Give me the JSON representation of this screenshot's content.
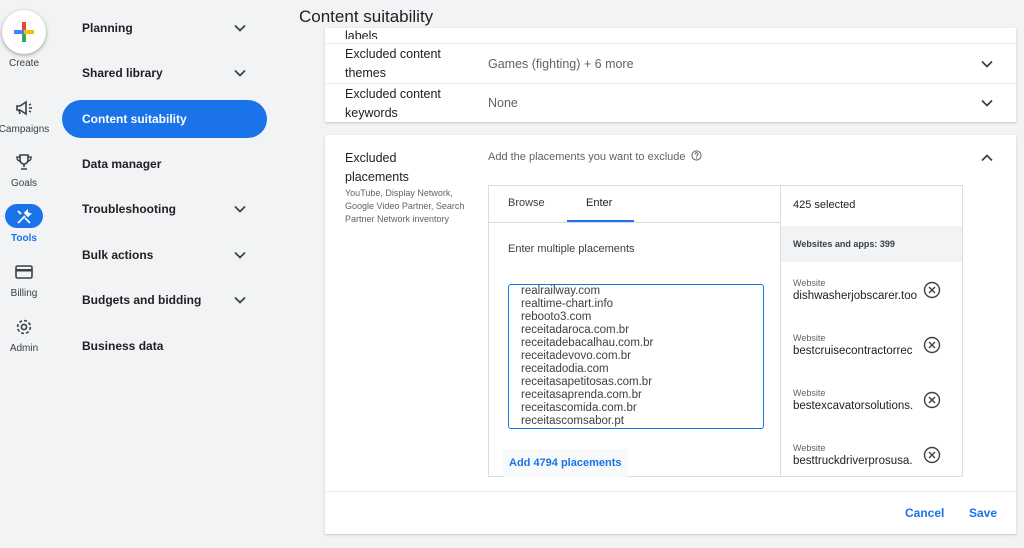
{
  "rail": {
    "create_label": "Create",
    "items": [
      {
        "label": "Campaigns",
        "icon": "megaphone-icon"
      },
      {
        "label": "Goals",
        "icon": "trophy-icon"
      },
      {
        "label": "Tools",
        "icon": "tools-icon"
      },
      {
        "label": "Billing",
        "icon": "credit-card-icon"
      },
      {
        "label": "Admin",
        "icon": "gear-icon"
      }
    ]
  },
  "nav": {
    "items": [
      {
        "label": "Planning",
        "expandable": true
      },
      {
        "label": "Shared library",
        "expandable": true
      },
      {
        "label": "Content suitability",
        "active": true
      },
      {
        "label": "Data manager"
      },
      {
        "label": "Troubleshooting",
        "expandable": true
      },
      {
        "label": "Bulk actions",
        "expandable": true
      },
      {
        "label": "Budgets and bidding",
        "expandable": true
      },
      {
        "label": "Business data"
      }
    ]
  },
  "page": {
    "title": "Content suitability"
  },
  "rows": {
    "labels_cut": "labels",
    "themes": {
      "label_line1": "Excluded content",
      "label_line2": "themes",
      "value": "Games (fighting) + 6 more"
    },
    "keywords": {
      "label_line1": "Excluded content",
      "label_line2": "keywords",
      "value": "None"
    }
  },
  "placements": {
    "label_line1": "Excluded",
    "label_line2": "placements",
    "sub_label": "YouTube, Display Network, Google Video Partner, Search Partner Network inventory",
    "instruction": "Add the placements you want to exclude",
    "tabs": {
      "browse": "Browse",
      "enter": "Enter"
    },
    "enter_title": "Enter multiple placements",
    "textarea_value": "realrailway.com\nrealtime-chart.info\nrebooto3.com\nreceitadaroca.com.br\nreceitadebacalhau.com.br\nreceitadevovo.com.br\nreceitadodia.com\nreceitasapetitosas.com.br\nreceitasaprenda.com.br\nreceitascomida.com.br\nreceitascomsabor.pt",
    "add_button": "Add 4794 placements",
    "selected_count": "425 selected",
    "group_label": "Websites and apps: 399",
    "selected_items": [
      {
        "type": "Website",
        "url": "dishwasherjobscarer.too"
      },
      {
        "type": "Website",
        "url": "bestcruisecontractorrec"
      },
      {
        "type": "Website",
        "url": "bestexcavatorsolutions."
      },
      {
        "type": "Website",
        "url": "besttruckdriverprosusa."
      }
    ]
  },
  "footer": {
    "cancel": "Cancel",
    "save": "Save"
  },
  "colors": {
    "accent": "#1a73e8",
    "background": "#f1f3f4"
  }
}
